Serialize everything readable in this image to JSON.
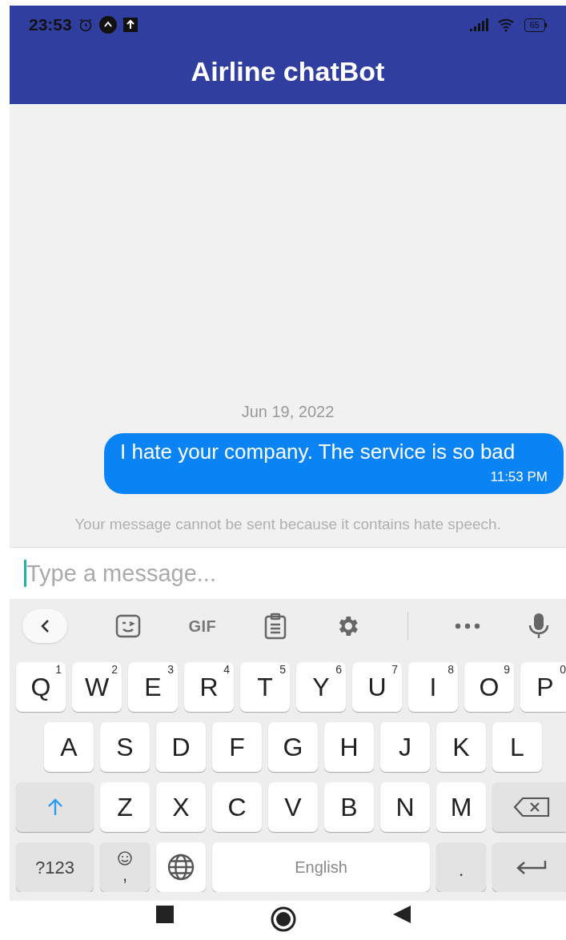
{
  "status_bar": {
    "time": "23:53",
    "battery": "65"
  },
  "app_bar": {
    "title": "Airline chatBot"
  },
  "chat": {
    "date": "Jun 19, 2022",
    "messages": [
      {
        "text": "I hate your company. The service is so bad",
        "time": "11:53 PM",
        "outgoing": true
      }
    ],
    "notice": "Your message cannot be sent because it contains hate speech."
  },
  "composer": {
    "placeholder": "Type a message...",
    "focused": true
  },
  "keyboard": {
    "toolbar": [
      {
        "kind": "back"
      },
      {
        "kind": "sticker"
      },
      {
        "kind": "gif",
        "label": "GIF"
      },
      {
        "kind": "clipboard"
      },
      {
        "kind": "settings"
      },
      {
        "kind": "divider"
      },
      {
        "kind": "more"
      },
      {
        "kind": "mic"
      }
    ],
    "rows": [
      {
        "keys": [
          {
            "kind": "letter",
            "label": "Q",
            "hint": "1"
          },
          {
            "kind": "letter",
            "label": "W",
            "hint": "2"
          },
          {
            "kind": "letter",
            "label": "E",
            "hint": "3"
          },
          {
            "kind": "letter",
            "label": "R",
            "hint": "4"
          },
          {
            "kind": "letter",
            "label": "T",
            "hint": "5"
          },
          {
            "kind": "letter",
            "label": "Y",
            "hint": "6"
          },
          {
            "kind": "letter",
            "label": "U",
            "hint": "7"
          },
          {
            "kind": "letter",
            "label": "I",
            "hint": "8"
          },
          {
            "kind": "letter",
            "label": "O",
            "hint": "9"
          },
          {
            "kind": "letter",
            "label": "P",
            "hint": "0"
          }
        ]
      },
      {
        "keys": [
          {
            "kind": "letter",
            "label": "A"
          },
          {
            "kind": "letter",
            "label": "S"
          },
          {
            "kind": "letter",
            "label": "D"
          },
          {
            "kind": "letter",
            "label": "F"
          },
          {
            "kind": "letter",
            "label": "G"
          },
          {
            "kind": "letter",
            "label": "H"
          },
          {
            "kind": "letter",
            "label": "J"
          },
          {
            "kind": "letter",
            "label": "K"
          },
          {
            "kind": "letter",
            "label": "L"
          }
        ]
      },
      {
        "keys": [
          {
            "kind": "shift",
            "on": true
          },
          {
            "kind": "letter",
            "label": "Z"
          },
          {
            "kind": "letter",
            "label": "X"
          },
          {
            "kind": "letter",
            "label": "C"
          },
          {
            "kind": "letter",
            "label": "V"
          },
          {
            "kind": "letter",
            "label": "B"
          },
          {
            "kind": "letter",
            "label": "N"
          },
          {
            "kind": "letter",
            "label": "M"
          },
          {
            "kind": "backspace"
          }
        ]
      },
      {
        "keys": [
          {
            "kind": "symbols",
            "label": "?123"
          },
          {
            "kind": "emoji",
            "label": ","
          },
          {
            "kind": "globe"
          },
          {
            "kind": "space",
            "label": "English"
          },
          {
            "kind": "period",
            "label": "."
          },
          {
            "kind": "enter"
          }
        ]
      }
    ]
  }
}
